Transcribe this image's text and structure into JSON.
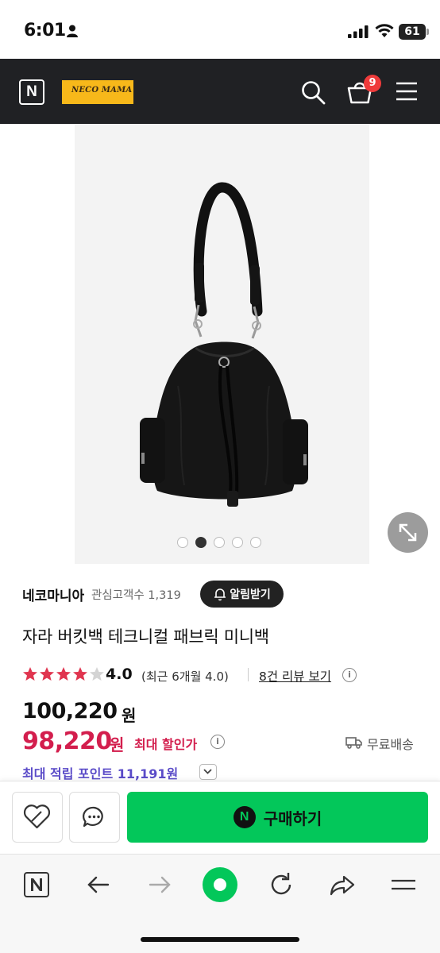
{
  "status_bar": {
    "time": "6:01",
    "battery": "61"
  },
  "header": {
    "home_logo": "N",
    "store_logo_text": "NECO MAMA",
    "cart_count": "9",
    "icons": [
      "search-icon",
      "cart-icon",
      "menu-icon"
    ]
  },
  "gallery": {
    "total_images": 5,
    "active_index": 1
  },
  "store": {
    "name": "네코마니아",
    "interest_text": "관심고객수 1,319",
    "alarm_label": "알림받기"
  },
  "product": {
    "title": "자라 버킷백 테크니컬 패브릭 미니백",
    "rating_stars": 4,
    "rating": "4.0",
    "rating_note": "(최근 6개월 4.0)",
    "reviews_link": "8건 리뷰 보기",
    "original_price": "100,220",
    "original_unit": "원",
    "sale_price": "98,220",
    "sale_unit": "원",
    "max_discount_label": "최대 할인가",
    "shipping": "무료배송",
    "points_text": "최대 적립 포인트 11,191원"
  },
  "actions": {
    "buy_label": "구매하기",
    "buy_icon": "N"
  },
  "colors": {
    "header_bg": "#202124",
    "accent_green": "#03c75a",
    "sale_red": "#d31e4d",
    "points_purple": "#5a4bc8",
    "star_red": "#e0354f"
  }
}
